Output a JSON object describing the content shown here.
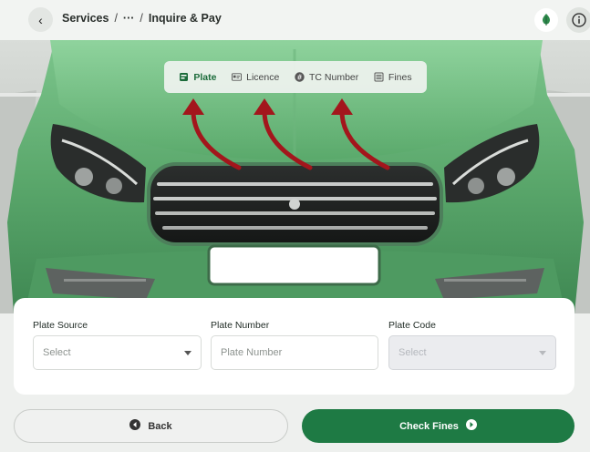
{
  "header": {
    "breadcrumb": [
      "Services",
      "···",
      "Inquire & Pay"
    ],
    "separator": "/"
  },
  "tabs": [
    {
      "label": "Plate",
      "icon": "plate-icon",
      "active": true
    },
    {
      "label": "Licence",
      "icon": "licence-icon",
      "active": false
    },
    {
      "label": "TC Number",
      "icon": "hash-icon",
      "active": false
    },
    {
      "label": "Fines",
      "icon": "list-icon",
      "active": false
    }
  ],
  "form": {
    "plate_source": {
      "label": "Plate Source",
      "value": "Select"
    },
    "plate_number": {
      "label": "Plate Number",
      "placeholder": "Plate Number"
    },
    "plate_code": {
      "label": "Plate Code",
      "value": "Select",
      "disabled": true
    }
  },
  "buttons": {
    "back": "Back",
    "check": "Check Fines"
  },
  "colors": {
    "accent": "#1e7a44",
    "car": "#5ba86c",
    "arrow": "#a3161c"
  }
}
